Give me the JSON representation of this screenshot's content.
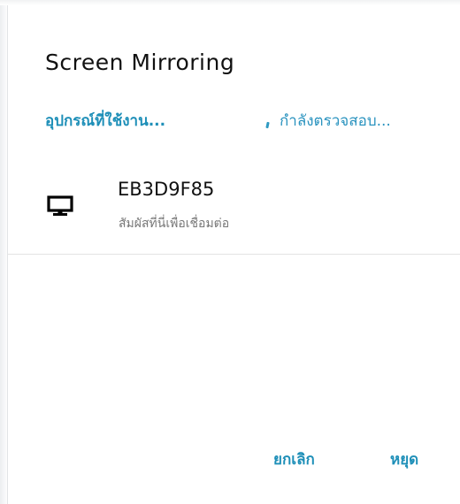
{
  "dialog": {
    "title": "Screen Mirroring",
    "section_label": "อุปกรณ์ที่ใช้งาน...",
    "scan_status": "กำลังตรวจสอบ...",
    "devices": [
      {
        "name": "EB3D9F85",
        "subtitle": "สัมผัสที่นี่เพื่อเชื่อมต่อ",
        "icon": "monitor-icon"
      }
    ],
    "buttons": {
      "cancel": "ยกเลิก",
      "stop": "หยุด"
    }
  },
  "colors": {
    "accent": "#1e8fb8",
    "title_text": "#111111",
    "subtitle_text": "#777777",
    "divider": "#e3e3e3",
    "background": "#ffffff"
  }
}
